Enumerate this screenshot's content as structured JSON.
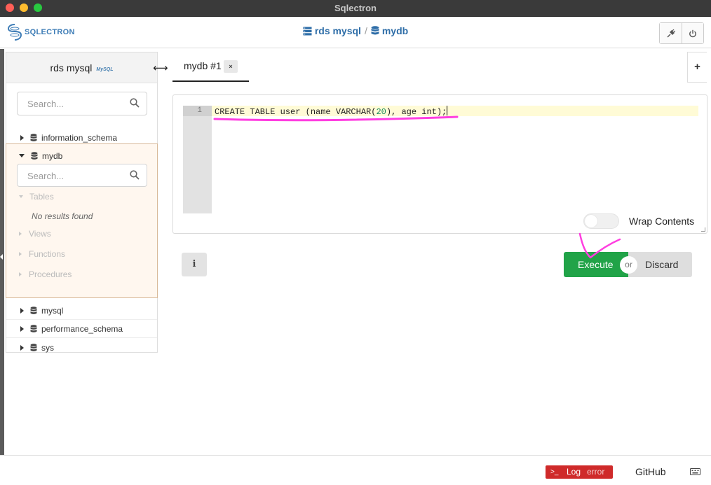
{
  "window": {
    "title": "Sqlectron"
  },
  "header": {
    "logo_text": "SQLECTRON",
    "breadcrumb": {
      "server": "rds mysql",
      "separator": "/",
      "database": "mydb"
    }
  },
  "sidebar": {
    "server_name": "rds mysql",
    "server_logo_text": "MySQL",
    "search_placeholder": "Search...",
    "databases": [
      {
        "name": "information_schema"
      },
      {
        "name": "mydb"
      },
      {
        "name": "mysql"
      },
      {
        "name": "performance_schema"
      },
      {
        "name": "sys"
      }
    ],
    "expanded_db": {
      "search_placeholder": "Search...",
      "sections": [
        "Tables",
        "Views",
        "Functions",
        "Procedures"
      ],
      "empty_message": "No results found"
    }
  },
  "tabs": [
    {
      "label": "mydb #1",
      "close": "×"
    }
  ],
  "add_tab_label": "+",
  "editor": {
    "line_number": "1",
    "code": {
      "before_num": "CREATE TABLE user (name VARCHAR(",
      "num": "20",
      "after_num": "), age int);"
    },
    "wrap_label": "Wrap Contents",
    "wrap_enabled": false
  },
  "actions": {
    "info_label": "i",
    "execute_label": "Execute",
    "or_label": "or",
    "discard_label": "Discard"
  },
  "footer": {
    "log_prompt": ">_",
    "log_label": "Log",
    "log_status": "error",
    "github_label": "GitHub"
  },
  "colors": {
    "execute": "#21a348",
    "log_error": "#cf2a2a",
    "breadcrumb": "#2f6ea8",
    "annotation": "#ff3ee0"
  }
}
